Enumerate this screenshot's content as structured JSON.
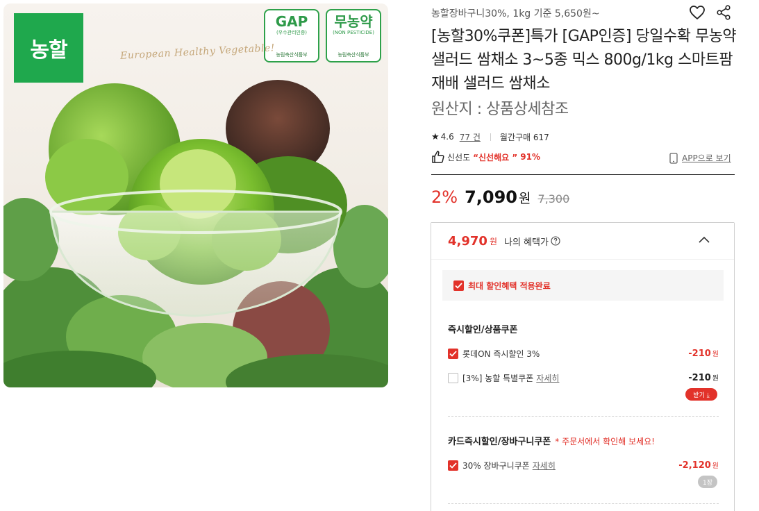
{
  "image": {
    "brand_logo": "농할",
    "script_text": "European Healthy Vegetable!",
    "cert_gap": {
      "big": "GAP",
      "small": "(우수관리인증)",
      "foot": "농림축산식품부"
    },
    "cert_nonpesticide": {
      "big": "무농약",
      "small": "(NON PESTICIDE)",
      "foot": "농림축산식품부"
    }
  },
  "header": {
    "coupon_line": "농할장바구니30%, 1kg 기준 5,650원~",
    "wish_icon": "heart-outline-icon",
    "share_icon": "share-icon"
  },
  "product": {
    "title": "[농할30%쿠폰]특가 [GAP인증] 당일수확 무농약 샐러드 쌈채소 3~5종 믹스 800g/1kg 스마트팜 재배 샐러드 쌈채소",
    "origin": "원산지 : 상품상세참조"
  },
  "rating": {
    "star": "★",
    "score": "4.6",
    "review_count": "77 건",
    "monthly_sales": "월간구매 617"
  },
  "freshness": {
    "label": "신선도",
    "value": "“신선해요 ”",
    "percent": "91%"
  },
  "app_link": "APP으로 보기",
  "price": {
    "discount_rate": "2%",
    "sale_price": "7,090",
    "won": "원",
    "original_price": "7,300"
  },
  "benefit": {
    "my_price": "4,970",
    "my_won": "원",
    "my_label": "나의 혜택가",
    "max_applied": "최대 할인혜택 적용완료",
    "section1_title": "즉시할인/상품쿠폰",
    "coupon1": {
      "label": "롯데ON 즉시할인 3%",
      "amount": "-210",
      "won": "원",
      "checked": true
    },
    "coupon2": {
      "label": "[3%] 농할 특별쿠폰",
      "detail": "자세히",
      "amount": "-210",
      "won": "원",
      "checked": false,
      "download": "받기 ⤓"
    },
    "section2_title": "카드즉시할인/장바구니쿠폰",
    "section2_note": "* 주문서에서 확인해 보세요!",
    "coupon3": {
      "label": "30% 장바구니쿠폰",
      "detail": "자세히",
      "amount": "-2,120",
      "won": "원",
      "checked": true,
      "qty": "1장"
    }
  },
  "colors": {
    "accent_red": "#e2322a",
    "brand_green": "#1fa84d"
  }
}
